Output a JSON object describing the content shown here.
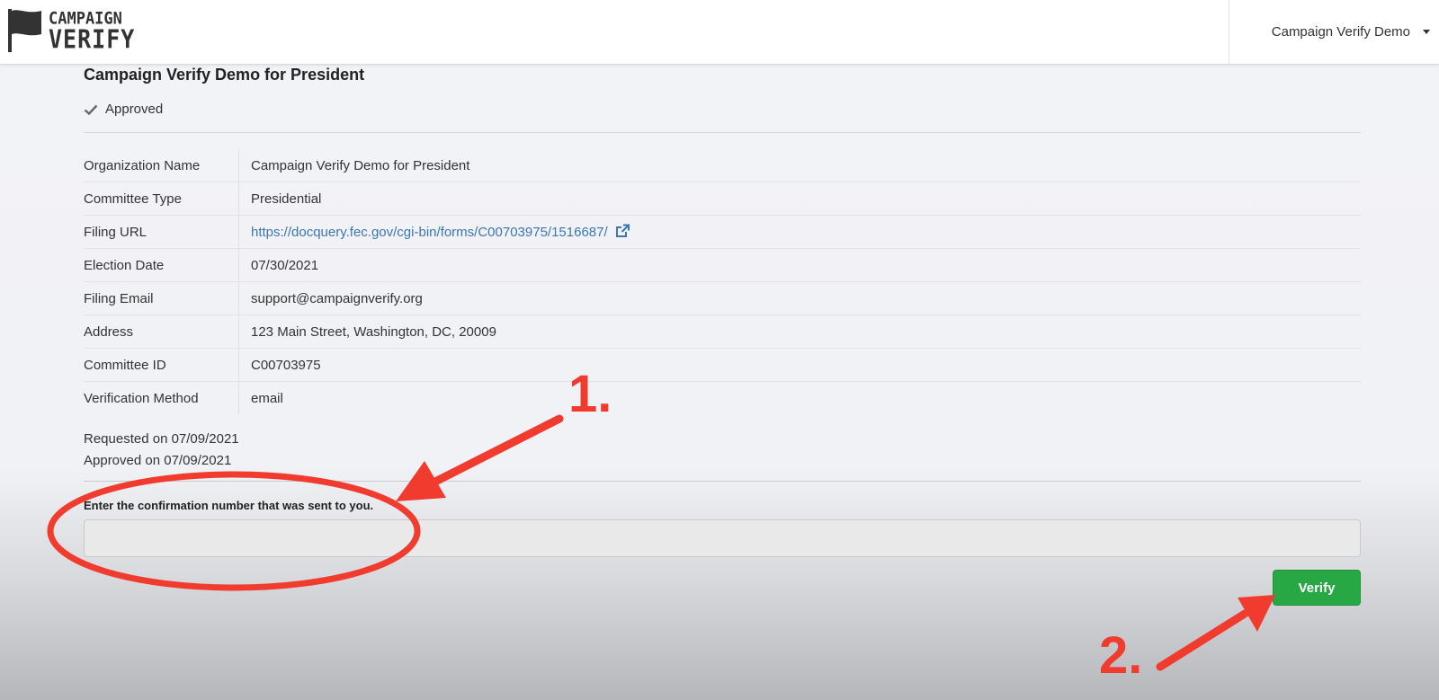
{
  "app": {
    "logo_line1": "CAMPAIGN",
    "logo_line2": "VERIFY",
    "user_menu_label": "Campaign Verify Demo"
  },
  "organization": {
    "title": "Campaign Verify Demo for President",
    "status": "Approved"
  },
  "details": [
    {
      "label": "Organization Name",
      "value": "Campaign Verify Demo for President"
    },
    {
      "label": "Committee Type",
      "value": "Presidential"
    },
    {
      "label": "Filing URL",
      "value": "https://docquery.fec.gov/cgi-bin/forms/C00703975/1516687/"
    },
    {
      "label": "Election Date",
      "value": "07/30/2021"
    },
    {
      "label": "Filing Email",
      "value": "support@campaignverify.org"
    },
    {
      "label": "Address",
      "value": "123 Main Street, Washington, DC, 20009"
    },
    {
      "label": "Committee ID",
      "value": "C00703975"
    },
    {
      "label": "Verification Method",
      "value": "email"
    }
  ],
  "dates": {
    "requested": "Requested on 07/09/2021",
    "approved": "Approved on 07/09/2021"
  },
  "confirmation": {
    "prompt": "Enter the confirmation number that was sent to you.",
    "value": "",
    "placeholder": ""
  },
  "actions": {
    "verify_label": "Verify"
  },
  "annotations": {
    "step1": "1.",
    "step2": "2.",
    "color": "#f03b2e"
  },
  "colors": {
    "link": "#3a78b5",
    "verify_button": "#28a745"
  }
}
